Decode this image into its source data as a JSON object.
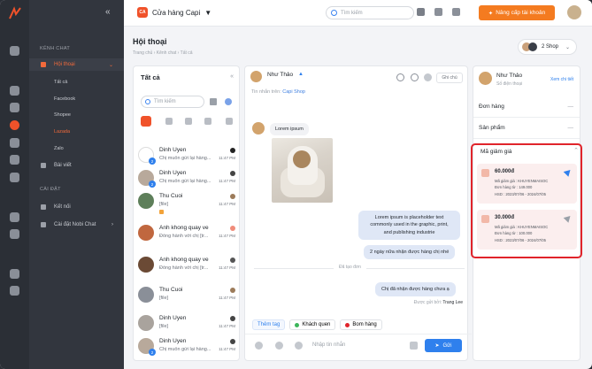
{
  "app": {
    "brand_color": "#f0522a",
    "accent": "#2f80ed"
  },
  "header": {
    "shop_logo": "CA",
    "shop_name": "Cửa hàng Capi",
    "search_placeholder": "Tìm kiếm",
    "upgrade_label": "Nâng cấp tài khoản",
    "collapse": "«"
  },
  "nav": {
    "section1": "KÊNH CHAT",
    "section2": "CÀI ĐẶT",
    "items": [
      {
        "label": "Hội thoại"
      },
      {
        "label": "Bài viết"
      },
      {
        "label": "Kết nối"
      },
      {
        "label": "Cài đặt Nobi Chat"
      }
    ],
    "subs": [
      "Tất cả",
      "Facebook",
      "Shopee",
      "Lazada",
      "Zalo"
    ]
  },
  "page": {
    "title": "Hội thoại",
    "breadcrumb": "Trang chủ  ›  Kênh chat  ›  Tất cả",
    "shop_switch": "2 Shop"
  },
  "list": {
    "title": "Tất cả",
    "search_placeholder": "Tìm kiếm",
    "conversations": [
      {
        "name": "Dinh Uyen",
        "preview": "Chị muốn gửi lại hàng...",
        "time": "11:47 PM",
        "badge": "2"
      },
      {
        "name": "Dinh Uyen",
        "preview": "Chị muốn gửi lại hàng...",
        "time": "11:47 PM",
        "badge": "2"
      },
      {
        "name": "Thu Cuoi",
        "preview": "[file]",
        "time": "11:47 PM",
        "badge": ""
      },
      {
        "name": "Anh khong quay ve",
        "preview": "Đồng hành với chị [tr...",
        "time": "11:47 PM",
        "badge": ""
      },
      {
        "name": "Anh khong quay ve",
        "preview": "Đồng hành với chị [tr...",
        "time": "11:47 PM",
        "badge": ""
      },
      {
        "name": "Thu Cuoi",
        "preview": "[file]",
        "time": "11:47 PM",
        "badge": ""
      },
      {
        "name": "Dinh Uyen",
        "preview": "[file]",
        "time": "11:47 PM",
        "badge": ""
      },
      {
        "name": "Dinh Uyen",
        "preview": "Chị muốn gửi lại hàng...",
        "time": "11:47 PM",
        "badge": "2"
      }
    ]
  },
  "chat": {
    "contact": "Như Thảo",
    "note_label": "Ghi chú",
    "from_prefix": "Tin nhắn trên:",
    "from_shop": "Capi Shop",
    "msg1": "Lorem ipsum",
    "msg2_l1": "Lorem ipsum is placeholder text",
    "msg2_l2": "commonly used in the graphic, print,",
    "msg2_l3": "and publishing industrie",
    "msg3": "2 ngày nữa nhận được hàng chị nhé",
    "divider": "Đã tạo đơn",
    "msg4": "Chị đã nhận được hàng chưa ạ",
    "sent_by_prefix": "Được gửi bởi:",
    "sent_by": "Trang Lee",
    "tags": [
      "Thêm tag",
      "Khách quen",
      "Bom hàng"
    ],
    "input_placeholder": "Nhập tin nhắn",
    "send": "Gửi"
  },
  "right": {
    "name": "Như Thảo",
    "phone": "Số điện thoại",
    "more": "Xem chi tiết",
    "rows": [
      {
        "label": "Đơn hàng"
      },
      {
        "label": "Sản phẩm"
      }
    ],
    "voucher_title": "Mã giảm giá",
    "vouchers": [
      {
        "amount": "60.000đ",
        "code": "Mã giảm giá : KHUYENMAISOC",
        "min": "Đơn hàng từ : 149.000",
        "hsd": "HSD : 2023/07/06 - 2024/07/05"
      },
      {
        "amount": "30.000đ",
        "code": "Mã giảm giá : KHUYENMAISOC",
        "min": "Đơn hàng từ : 100.000",
        "hsd": "HSD : 2023/07/06 - 2024/07/05"
      }
    ]
  }
}
